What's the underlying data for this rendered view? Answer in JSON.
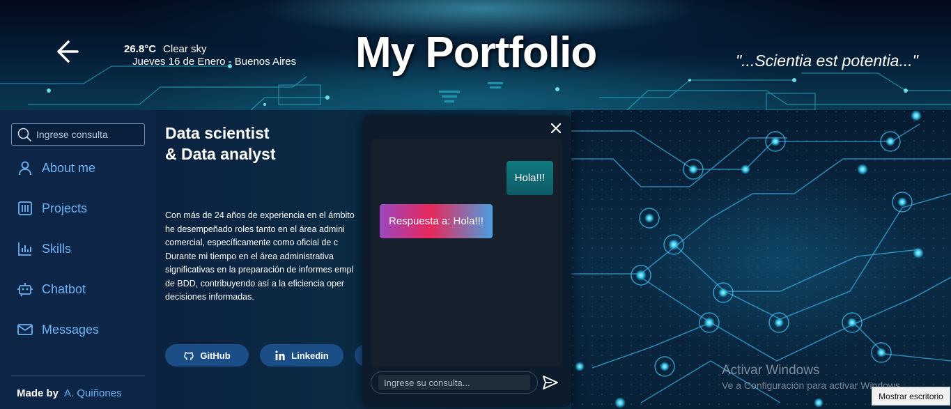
{
  "header": {
    "title": "My Portfolio",
    "motto": "\"...Scientia est potentia...\"",
    "weather": {
      "temperature": "26.8°C",
      "condition": "Clear sky",
      "date_location": "Jueves 16 de Enero - Buenos Aires"
    }
  },
  "sidebar": {
    "search_placeholder": "Ingrese consulta",
    "items": [
      {
        "label": "About me",
        "icon": "user-icon"
      },
      {
        "label": "Projects",
        "icon": "projects-icon"
      },
      {
        "label": "Skills",
        "icon": "bar-chart-icon"
      },
      {
        "label": "Chatbot",
        "icon": "robot-icon"
      },
      {
        "label": "Messages",
        "icon": "mail-icon"
      }
    ],
    "made_by_label": "Made by",
    "author": "A. Quiñones"
  },
  "main": {
    "role_line1": "Data scientist",
    "role_line2": "& Data analyst",
    "bio_lines": [
      "Con más de 24 años de experiencia en el ámbito",
      "he desempeñado roles tanto en el área admini",
      "comercial, específicamente como oficial de c",
      "Durante mi tiempo en el área administrativa",
      "significativas en la preparación de informes empl",
      "de BDD, contribuyendo así a la eficiencia oper",
      "decisiones informadas."
    ],
    "buttons": {
      "github": "GitHub",
      "linkedin": "Linkedin"
    }
  },
  "chat": {
    "user_message": "Hola!!!",
    "bot_message": "Respuesta a: Hola!!!",
    "input_placeholder": "Ingrese su consulta..."
  },
  "watermark": {
    "title": "Activar Windows",
    "subtitle": "Ve a Configuración para activar Windows.",
    "desktop_button": "Mostrar escritorio"
  },
  "colors": {
    "sidebar_bg": "#0d2546",
    "accent_link": "#6cb4f5",
    "pill_bg": "#1b4d86",
    "chat_bg": "#0c1c2c",
    "user_bubble": "#127a82"
  }
}
